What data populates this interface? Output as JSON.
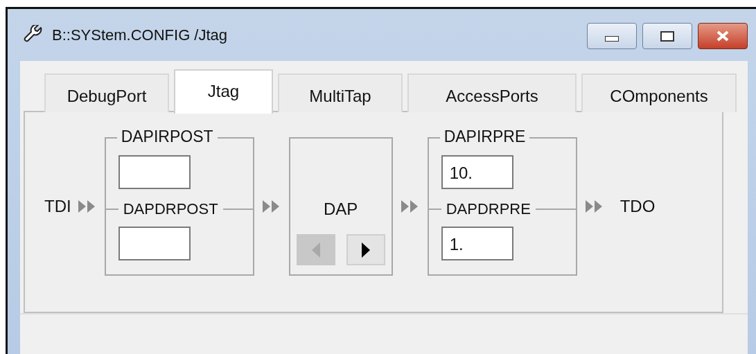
{
  "window": {
    "title": "B::SYStem.CONFIG /Jtag"
  },
  "tabs": [
    {
      "label": "DebugPort",
      "selected": false
    },
    {
      "label": "Jtag",
      "selected": true
    },
    {
      "label": "MultiTap",
      "selected": false
    },
    {
      "label": "AccessPorts",
      "selected": false
    },
    {
      "label": "COmponents",
      "selected": false
    }
  ],
  "chain": {
    "input": "TDI",
    "output": "TDO",
    "post": {
      "ir_label": "DAPIRPOST",
      "dr_label": "DAPDRPOST"
    },
    "dap": {
      "label": "DAP",
      "prev_disabled": true,
      "next_disabled": false
    },
    "pre": {
      "ir_label": "DAPIRPRE",
      "ir_value": "10.",
      "dr_label": "DAPDRPRE",
      "dr_value": "1."
    }
  }
}
